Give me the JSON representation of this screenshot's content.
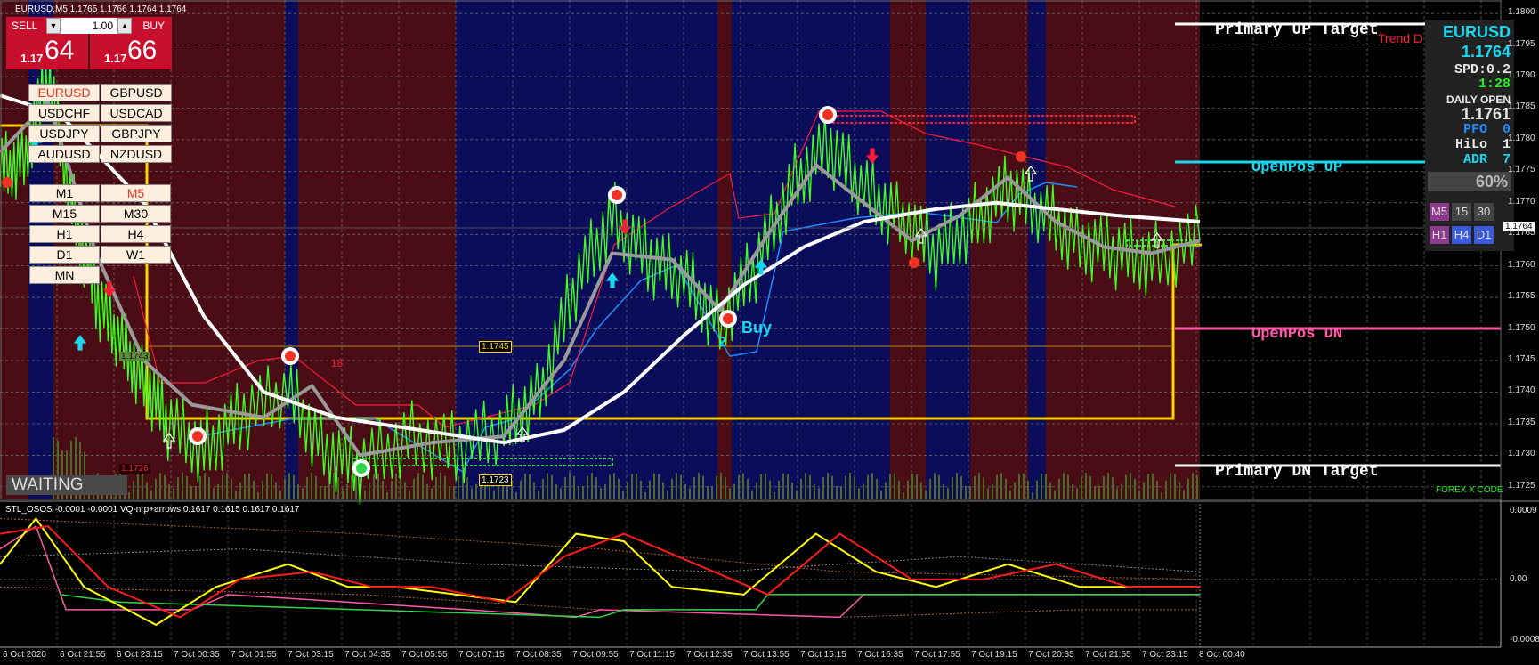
{
  "window": {
    "title": "EURUSD,M5  1.1765 1.1766 1.1764 1.1764"
  },
  "trade": {
    "sell_label": "SELL",
    "buy_label": "BUY",
    "lot": "1.00",
    "sell_small": "1.17",
    "sell_big": "64",
    "buy_small": "1.17",
    "buy_big": "66"
  },
  "symbols": [
    "EURUSD",
    "GBPUSD",
    "USDCHF",
    "USDCAD",
    "USDJPY",
    "GBPJPY",
    "AUDUSD",
    "NZDUSD"
  ],
  "active_symbol": "EURUSD",
  "timeframes": [
    "M1",
    "M5",
    "M15",
    "M30",
    "H1",
    "H4",
    "D1",
    "W1",
    "MN"
  ],
  "active_timeframe": "M5",
  "info": {
    "symbol": "EURUSD",
    "price": "1.1764",
    "spread": "SPD:0.2",
    "timer": "1:28",
    "daily_open_label": "DAILY OPEN",
    "daily_open": "1.1761",
    "pfo_label": "PFO",
    "pfo_value": "0",
    "hilo_label": "HiLo",
    "hilo_value": "1",
    "adr_label": "ADR",
    "adr_value": "7",
    "percent": "60%",
    "tf_row1": [
      "M5",
      "15",
      "30"
    ],
    "tf_row2": [
      "H1",
      "H4",
      "D1"
    ]
  },
  "levels": {
    "primary_up": "Primary UP Target",
    "primary_dn": "Primary DN Target",
    "openpos_up": "OpenPos UP",
    "openpos_dn": "OpenPos DN",
    "trend_text": "Trend D"
  },
  "signals": {
    "buy_text": "Buy",
    "buy_num": "2",
    "count_18": "18"
  },
  "price_tags": {
    "p1745": "1.1745",
    "p1723": "1.1723",
    "p1743": "1.1743",
    "p1726": "1.1726"
  },
  "status": {
    "waiting": "WAITING",
    "brand": "FOREX X CODE"
  },
  "oscillator": {
    "label": "STL_OSOS -0.0001 -0.0001  VQ-nrp+arrows 0.1617 0.1615 0.1617 0.1617"
  },
  "colors": {
    "bg": "#000000",
    "bear_zone": "#4a0d16",
    "bull_zone": "#0b0d5a",
    "price_green": "#3dff1e",
    "ma_white": "#ffffff",
    "ma_gray": "#9a9a9a",
    "box_yellow": "#ffd200",
    "trail_blue": "#1e8cff",
    "trail_red": "#ff1a3a",
    "cyan": "#18d8f0",
    "pink": "#ff5aa8",
    "osc_yellow": "#ffff00",
    "osc_red": "#ff1a1a"
  },
  "chart_data": {
    "type": "line",
    "symbol": "EURUSD",
    "timeframe": "M5",
    "y_ticks": [
      "1.1800",
      "1.1795",
      "1.1790",
      "1.1785",
      "1.1780",
      "1.1775",
      "1.1770",
      "1.1765",
      "1.1760",
      "1.1755",
      "1.1750",
      "1.1745",
      "1.1740",
      "1.1735",
      "1.1730",
      "1.1725"
    ],
    "ylim": [
      1.1723,
      1.1801
    ],
    "current_price": "1.1764",
    "x_ticks": [
      "6 Oct 2020",
      "6 Oct 21:55",
      "6 Oct 23:15",
      "7 Oct 00:35",
      "7 Oct 01:55",
      "7 Oct 03:15",
      "7 Oct 04:35",
      "7 Oct 05:55",
      "7 Oct 07:15",
      "7 Oct 08:35",
      "7 Oct 09:55",
      "7 Oct 11:15",
      "7 Oct 12:35",
      "7 Oct 13:55",
      "7 Oct 15:15",
      "7 Oct 16:35",
      "7 Oct 17:55",
      "7 Oct 19:15",
      "7 Oct 20:35",
      "7 Oct 21:55",
      "7 Oct 23:15",
      "8 Oct 00:40"
    ],
    "price_series": [
      [
        0,
        1.1775
      ],
      [
        0.02,
        1.1777
      ],
      [
        0.04,
        1.179
      ],
      [
        0.06,
        1.177
      ],
      [
        0.08,
        1.1755
      ],
      [
        0.1,
        1.1748
      ],
      [
        0.12,
        1.1742
      ],
      [
        0.14,
        1.1735
      ],
      [
        0.17,
        1.1731
      ],
      [
        0.2,
        1.1736
      ],
      [
        0.24,
        1.174
      ],
      [
        0.27,
        1.1731
      ],
      [
        0.3,
        1.1728
      ],
      [
        0.34,
        1.1733
      ],
      [
        0.38,
        1.1731
      ],
      [
        0.42,
        1.1734
      ],
      [
        0.45,
        1.174
      ],
      [
        0.48,
        1.1757
      ],
      [
        0.51,
        1.1768
      ],
      [
        0.54,
        1.1761
      ],
      [
        0.57,
        1.1758
      ],
      [
        0.6,
        1.1751
      ],
      [
        0.63,
        1.176
      ],
      [
        0.66,
        1.1773
      ],
      [
        0.69,
        1.1779
      ],
      [
        0.72,
        1.1772
      ],
      [
        0.75,
        1.1768
      ],
      [
        0.78,
        1.1762
      ],
      [
        0.81,
        1.1767
      ],
      [
        0.84,
        1.1772
      ],
      [
        0.87,
        1.1768
      ],
      [
        0.9,
        1.1764
      ],
      [
        0.93,
        1.1762
      ],
      [
        0.96,
        1.1761
      ],
      [
        1.0,
        1.1764
      ]
    ],
    "ma_white": [
      [
        0,
        1.1787
      ],
      [
        0.05,
        1.1784
      ],
      [
        0.12,
        1.177
      ],
      [
        0.17,
        1.1752
      ],
      [
        0.22,
        1.174
      ],
      [
        0.28,
        1.1736
      ],
      [
        0.35,
        1.1734
      ],
      [
        0.42,
        1.1732
      ],
      [
        0.47,
        1.1734
      ],
      [
        0.52,
        1.174
      ],
      [
        0.57,
        1.1749
      ],
      [
        0.62,
        1.1757
      ],
      [
        0.67,
        1.1763
      ],
      [
        0.72,
        1.1767
      ],
      [
        0.78,
        1.1769
      ],
      [
        0.83,
        1.177
      ],
      [
        0.88,
        1.1769
      ],
      [
        0.93,
        1.1768
      ],
      [
        1.0,
        1.1767
      ]
    ],
    "ma_gray": [
      [
        0,
        1.1778
      ],
      [
        0.04,
        1.1786
      ],
      [
        0.08,
        1.1762
      ],
      [
        0.12,
        1.1745
      ],
      [
        0.16,
        1.1738
      ],
      [
        0.22,
        1.1736
      ],
      [
        0.26,
        1.1741
      ],
      [
        0.3,
        1.173
      ],
      [
        0.36,
        1.1732
      ],
      [
        0.42,
        1.1733
      ],
      [
        0.47,
        1.1745
      ],
      [
        0.51,
        1.1762
      ],
      [
        0.56,
        1.1761
      ],
      [
        0.6,
        1.1753
      ],
      [
        0.64,
        1.1765
      ],
      [
        0.68,
        1.1776
      ],
      [
        0.72,
        1.177
      ],
      [
        0.76,
        1.1764
      ],
      [
        0.8,
        1.1768
      ],
      [
        0.84,
        1.1774
      ],
      [
        0.88,
        1.1767
      ],
      [
        0.92,
        1.1763
      ],
      [
        0.96,
        1.1762
      ],
      [
        1.0,
        1.1764
      ]
    ],
    "osc_ylim": [
      -0.0008,
      0.0009
    ],
    "osc_ticks": [
      "0.0009",
      "0.00",
      "-0.0008"
    ],
    "osc_yellow": [
      [
        0,
        0.0002
      ],
      [
        0.03,
        0.0008
      ],
      [
        0.07,
        -0.0001
      ],
      [
        0.13,
        -0.0006
      ],
      [
        0.18,
        -0.0001
      ],
      [
        0.24,
        0.0002
      ],
      [
        0.29,
        -0.0001
      ],
      [
        0.33,
        -0.0001
      ],
      [
        0.38,
        -0.0002
      ],
      [
        0.43,
        -0.0003
      ],
      [
        0.48,
        0.0006
      ],
      [
        0.52,
        0.0005
      ],
      [
        0.56,
        -0.0001
      ],
      [
        0.62,
        -0.0002
      ],
      [
        0.68,
        0.0006
      ],
      [
        0.73,
        0.0001
      ],
      [
        0.78,
        -0.0001
      ],
      [
        0.84,
        0.0002
      ],
      [
        0.9,
        -0.0001
      ],
      [
        0.95,
        -0.0001
      ],
      [
        1.0,
        -0.0001
      ]
    ],
    "osc_red": [
      [
        0,
        0.0006
      ],
      [
        0.04,
        0.0007
      ],
      [
        0.09,
        -0.0001
      ],
      [
        0.15,
        -0.0005
      ],
      [
        0.2,
        0.0
      ],
      [
        0.26,
        0.0001
      ],
      [
        0.31,
        -0.0001
      ],
      [
        0.36,
        -0.0001
      ],
      [
        0.42,
        -0.0003
      ],
      [
        0.47,
        0.0003
      ],
      [
        0.52,
        0.0006
      ],
      [
        0.58,
        0.0002
      ],
      [
        0.64,
        -0.0002
      ],
      [
        0.7,
        0.0006
      ],
      [
        0.76,
        0.0
      ],
      [
        0.82,
        0.0
      ],
      [
        0.88,
        0.0002
      ],
      [
        0.94,
        -0.0001
      ],
      [
        1.0,
        -0.0001
      ]
    ]
  }
}
